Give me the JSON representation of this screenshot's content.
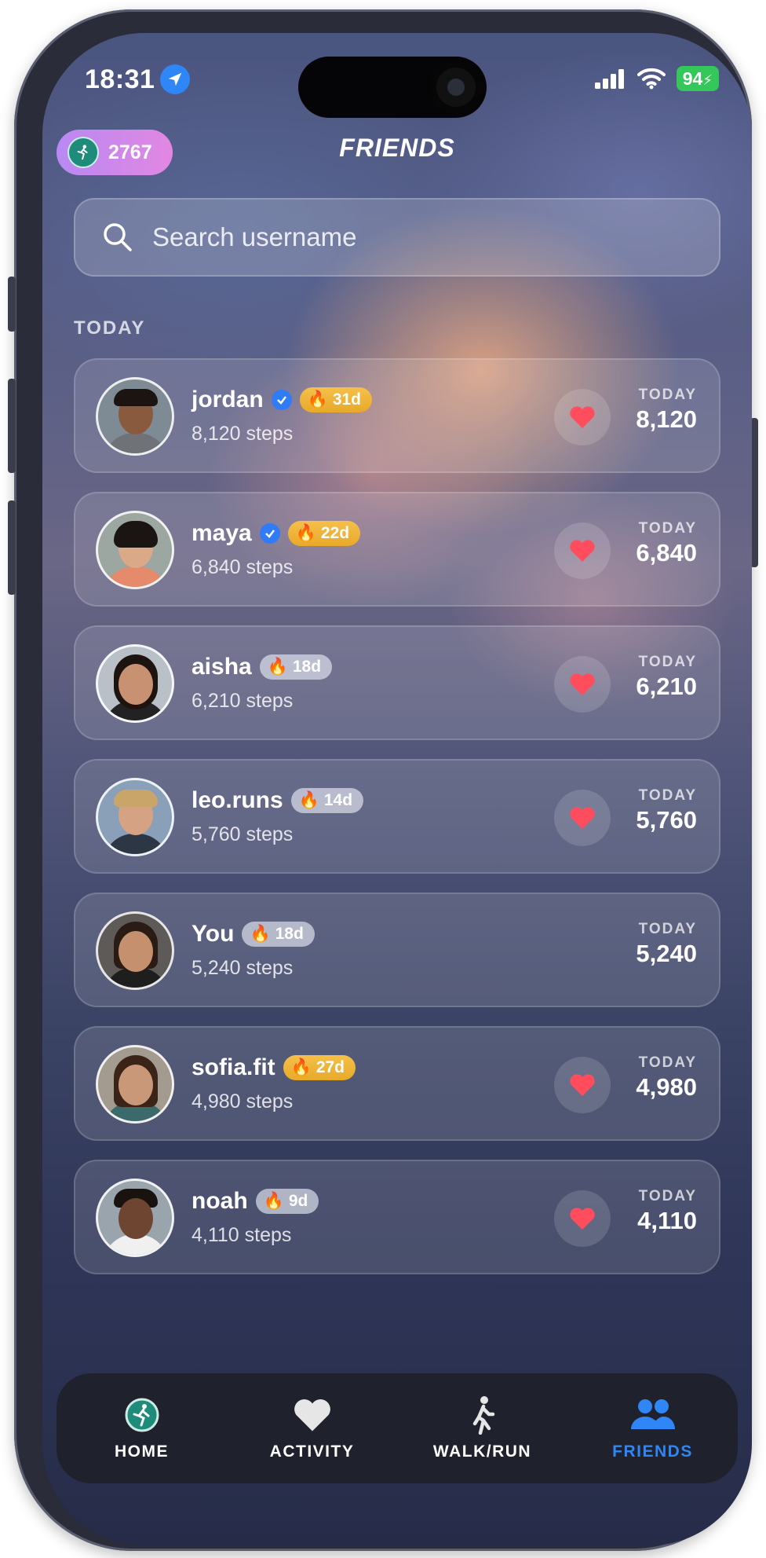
{
  "status_bar": {
    "time": "18:31",
    "battery": "94"
  },
  "header": {
    "points": "2767",
    "title": "FRIENDS"
  },
  "search": {
    "placeholder": "Search username"
  },
  "section_label": "TODAY",
  "today_label": "TODAY",
  "friends": [
    {
      "name": "jordan",
      "verified": true,
      "streak": "31d",
      "streak_style": "gold",
      "steps": "8,120 steps",
      "today": "8,120",
      "likeable": true
    },
    {
      "name": "maya",
      "verified": true,
      "streak": "22d",
      "streak_style": "gold",
      "steps": "6,840 steps",
      "today": "6,840",
      "likeable": true
    },
    {
      "name": "aisha",
      "verified": false,
      "streak": "18d",
      "streak_style": "silver",
      "steps": "6,210 steps",
      "today": "6,210",
      "likeable": true
    },
    {
      "name": "leo.runs",
      "verified": false,
      "streak": "14d",
      "streak_style": "silver",
      "steps": "5,760 steps",
      "today": "5,760",
      "likeable": true
    },
    {
      "name": "You",
      "verified": false,
      "streak": "18d",
      "streak_style": "silver",
      "steps": "5,240 steps",
      "today": "5,240",
      "likeable": false
    },
    {
      "name": "sofia.fit",
      "verified": false,
      "streak": "27d",
      "streak_style": "gold",
      "steps": "4,980 steps",
      "today": "4,980",
      "likeable": true
    },
    {
      "name": "noah",
      "verified": false,
      "streak": "9d",
      "streak_style": "silver",
      "steps": "4,110 steps",
      "today": "4,110",
      "likeable": true
    }
  ],
  "tabs": [
    {
      "label": "HOME",
      "icon": "runner-badge-icon",
      "active": false
    },
    {
      "label": "ACTIVITY",
      "icon": "heart-icon",
      "active": false
    },
    {
      "label": "WALK/RUN",
      "icon": "walking-icon",
      "active": false
    },
    {
      "label": "FRIENDS",
      "icon": "people-icon",
      "active": true
    }
  ],
  "colors": {
    "accent": "#2f86f6",
    "heart": "#ff4d5e",
    "streak_gold": "#f2b63a",
    "battery": "#34c759"
  }
}
